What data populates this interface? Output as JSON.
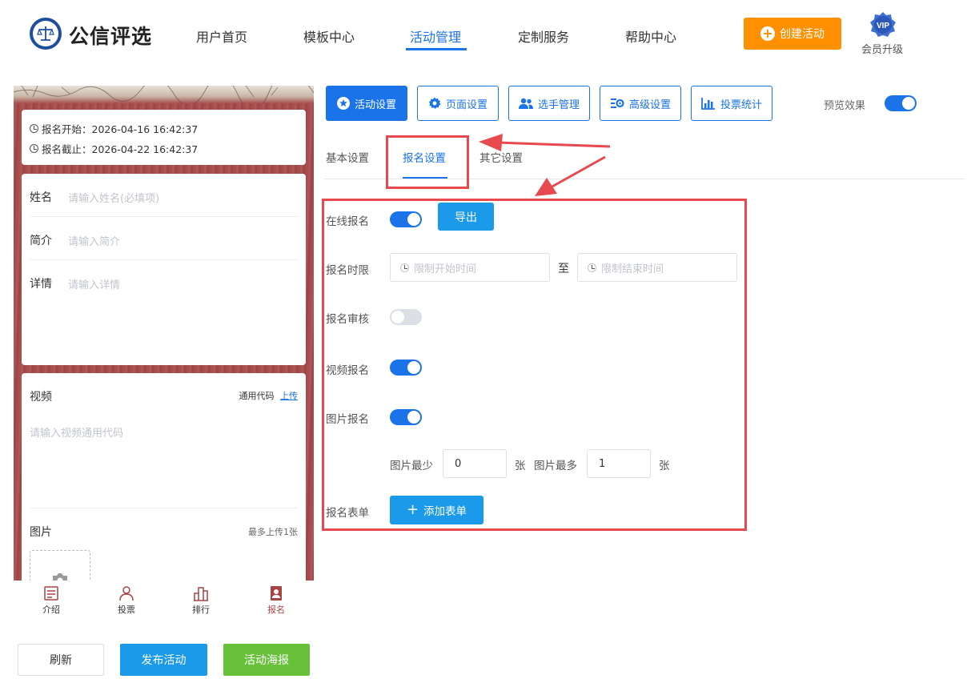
{
  "header": {
    "brand": "公信评选",
    "nav": [
      "用户首页",
      "模板中心",
      "活动管理",
      "定制服务",
      "帮助中心"
    ],
    "active_nav": "活动管理",
    "create_button": "创建活动",
    "vip_badge": "VIP",
    "vip_label": "会员升级"
  },
  "preview": {
    "signup_start": "报名开始：2026-04-16 16:42:37",
    "signup_end": "报名截止：2026-04-22 16:42:37",
    "fields": [
      {
        "label": "姓名",
        "placeholder": "请输入姓名(必填项)"
      },
      {
        "label": "简介",
        "placeholder": "请输入简介"
      },
      {
        "label": "详情",
        "placeholder": "请输入详情"
      }
    ],
    "video": {
      "label": "视频",
      "code_label": "通用代码",
      "upload_link": "上传",
      "placeholder": "请输入视频通用代码"
    },
    "image": {
      "label": "图片",
      "hint": "最多上传1张"
    },
    "tabs": [
      "介绍",
      "投票",
      "排行",
      "报名"
    ],
    "active_tab": "报名"
  },
  "bottom_buttons": {
    "refresh": "刷新",
    "publish": "发布活动",
    "poster": "活动海报"
  },
  "toolbar": {
    "buttons": [
      "活动设置",
      "页面设置",
      "选手管理",
      "高级设置",
      "投票统计"
    ],
    "active": "活动设置",
    "preview_label": "预览效果",
    "preview_on": true
  },
  "subtabs": {
    "items": [
      "基本设置",
      "报名设置",
      "其它设置"
    ],
    "active": "报名设置"
  },
  "form": {
    "online_signup": {
      "label": "在线报名",
      "on": true,
      "export_button": "导出"
    },
    "signup_period": {
      "label": "报名时限",
      "start_placeholder": "限制开始时间",
      "separator": "至",
      "end_placeholder": "限制结束时间"
    },
    "signup_review": {
      "label": "报名审核",
      "on": false
    },
    "video_signup": {
      "label": "视频报名",
      "on": true
    },
    "image_signup": {
      "label": "图片报名",
      "on": true
    },
    "image_min": {
      "label": "图片最少",
      "value": "0",
      "unit": "张"
    },
    "image_max": {
      "label": "图片最多",
      "value": "1",
      "unit": "张"
    },
    "signup_form": {
      "label": "报名表单",
      "add_button": "添加表单"
    }
  },
  "colors": {
    "primary": "#1a73e8",
    "orange": "#ff9000",
    "green": "#67c23a",
    "annotation_red": "#e8494f",
    "preview_bg": "#a64444"
  }
}
